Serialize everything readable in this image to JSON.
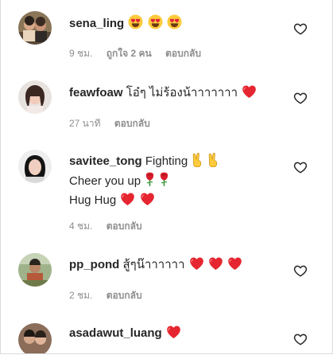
{
  "comments": [
    {
      "username": "sena_ling",
      "text": "",
      "emojis": [
        "heart-eyes",
        "heart-eyes",
        "heart-eyes"
      ],
      "time": "9 ชม.",
      "likes": "ถูกใจ 2 คน",
      "reply": "ตอบกลับ"
    },
    {
      "username": "feawfoaw",
      "text": "โอ๋ๆ ไม่ร้องน้าาาาาาา",
      "emojis": [
        "red-heart"
      ],
      "time": "27 นาที",
      "reply": "ตอบกลับ"
    },
    {
      "username": "savitee_tong",
      "text": "Fighting",
      "emojis": [
        "victory-hand",
        "victory-hand"
      ],
      "line2": "Cheer you up",
      "line2_emojis": [
        "rose",
        "rose"
      ],
      "line3": "Hug Hug",
      "line3_emojis": [
        "red-heart",
        "red-heart"
      ],
      "time": "4 ชม.",
      "reply": "ตอบกลับ"
    },
    {
      "username": "pp_pond",
      "text": "สู้ๆน๊าาาาาา",
      "emojis": [
        "red-heart",
        "red-heart",
        "red-heart"
      ],
      "time": "2 ชม.",
      "reply": "ตอบกลับ"
    },
    {
      "username": "asadawut_luang",
      "text": "",
      "emojis": [
        "red-heart"
      ]
    }
  ],
  "colors": {
    "text": "#262626",
    "meta": "#8e8e8e",
    "heart": "#ed4956",
    "emoji_face": "#fdcb3c"
  }
}
